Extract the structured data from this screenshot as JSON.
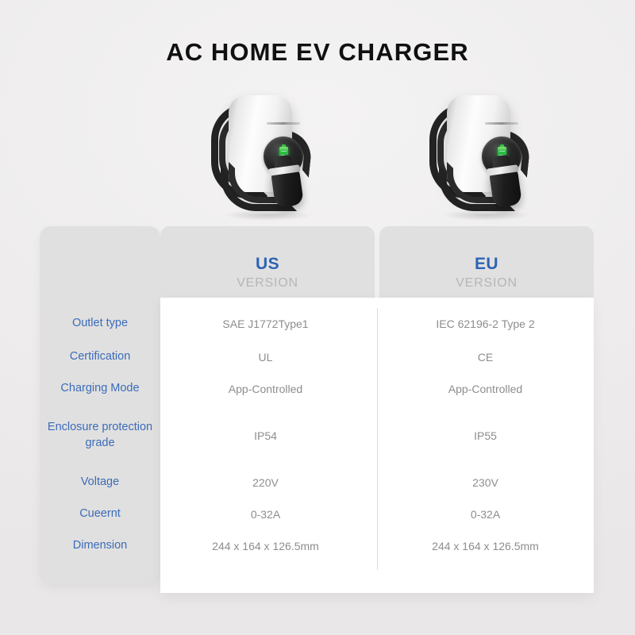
{
  "page": {
    "title": "AC HOME EV CHARGER",
    "background_color": "#eeecec",
    "accent_blue": "#2c63b5",
    "label_blue": "#3a6cb8",
    "value_gray": "#8d8d8d",
    "panel_gray": "#e1e0e0"
  },
  "products": [
    {
      "name": "US version AC home EV charger",
      "indicator_icon": "battery-icon",
      "indicator_color": "#2fbf48",
      "body_color": "#f2f2f2",
      "cable_color": "#222222"
    },
    {
      "name": "EU version AC home EV charger",
      "indicator_icon": "battery-icon",
      "indicator_color": "#2fbf48",
      "body_color": "#f2f2f2",
      "cable_color": "#222222"
    }
  ],
  "table": {
    "columns": [
      {
        "title": "US",
        "subtitle": "VERSION"
      },
      {
        "title": "EU",
        "subtitle": "VERSION"
      }
    ],
    "rows": [
      {
        "label": "Outlet type",
        "us": "SAE J1772Type1",
        "eu": "IEC 62196-2 Type 2"
      },
      {
        "label": "Certification",
        "us": "UL",
        "eu": "CE"
      },
      {
        "label": "Charging Mode",
        "us": "App-Controlled",
        "eu": "App-Controlled"
      },
      {
        "label": "Enclosure protection grade",
        "us": "IP54",
        "eu": "IP55"
      },
      {
        "label": "Voltage",
        "us": "220V",
        "eu": "230V"
      },
      {
        "label": "Cueernt",
        "us": "0-32A",
        "eu": "0-32A"
      },
      {
        "label": "Dimension",
        "us": "244 x 164 x 126.5mm",
        "eu": "244 x 164 x 126.5mm"
      }
    ]
  }
}
